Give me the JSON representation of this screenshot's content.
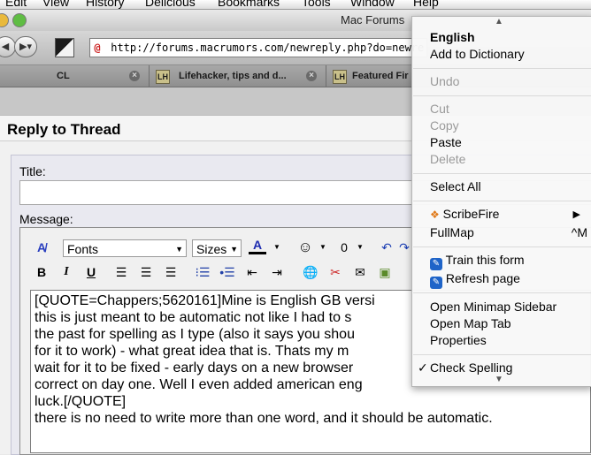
{
  "menubar": {
    "items": [
      "Edit",
      "View",
      "History",
      "Delicious",
      "Bookmarks",
      "Tools",
      "Window",
      "Help"
    ]
  },
  "window": {
    "title": "Mac Forums"
  },
  "toolbar": {
    "url": "http://forums.macrumors.com/newreply.php?do=newre"
  },
  "tabs": [
    {
      "label": "CL"
    },
    {
      "label": "Lifehacker, tips and d..."
    },
    {
      "label": "Featured Fir"
    }
  ],
  "panel": {
    "title": "Reply to Thread"
  },
  "form": {
    "title_label": "Title:",
    "message_label": "Message:"
  },
  "editor": {
    "font_select": "Fonts",
    "size_select": "Sizes",
    "bold": "B",
    "italic": "I",
    "underline": "U",
    "lines": [
      "[QUOTE=Chappers;5620161]Mine is English GB versi",
      "this is just meant to be automatic not like I had to s",
      "the past for spelling as I type (also it says you shou",
      "for it to work) - what great idea that is. Thats my m",
      "wait for it to be fixed - early days on a new browser",
      "correct on day one. Well I even added american eng",
      "luck.[/QUOTE]",
      "there is no need to write more than one word, and it should be automatic."
    ]
  },
  "context_menu": {
    "suggestion": "English",
    "add_to_dictionary": "Add to Dictionary",
    "undo": "Undo",
    "cut": "Cut",
    "copy": "Copy",
    "paste": "Paste",
    "delete": "Delete",
    "select_all": "Select All",
    "scribefire": "ScribeFire",
    "fullmap": "FullMap",
    "fullmap_shortcut": "^M",
    "train_form": "Train this form",
    "refresh_page": "Refresh page",
    "open_minimap": "Open Minimap Sidebar",
    "open_map_tab": "Open Map Tab",
    "properties": "Properties",
    "check_spelling": "Check Spelling",
    "check_mark": "✓"
  }
}
